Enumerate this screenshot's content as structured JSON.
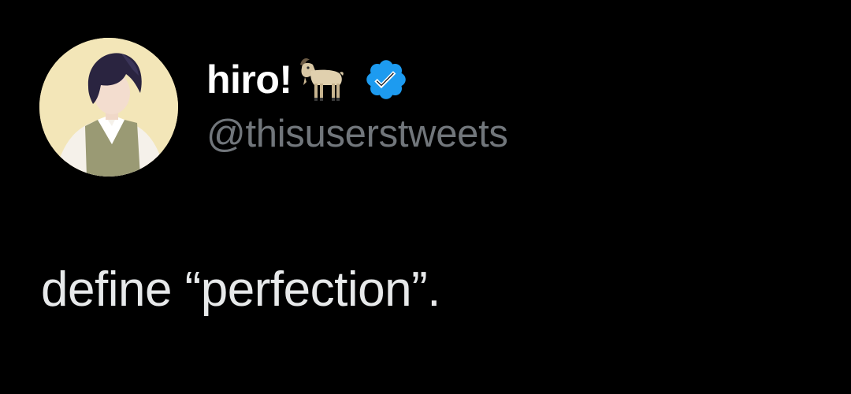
{
  "tweet": {
    "author": {
      "display_name": "hiro!",
      "name_emoji": "goat-icon",
      "verified": true,
      "verified_icon": "verified-badge-icon",
      "verified_color": "#1d9bf0",
      "handle": "@thisuserstweets",
      "avatar": "avatar-image"
    },
    "text": "define “perfection”."
  },
  "colors": {
    "background": "#000000",
    "name": "#ffffff",
    "handle": "#71767b",
    "body_text": "#e7e9ea",
    "verified_blue": "#1d9bf0"
  }
}
